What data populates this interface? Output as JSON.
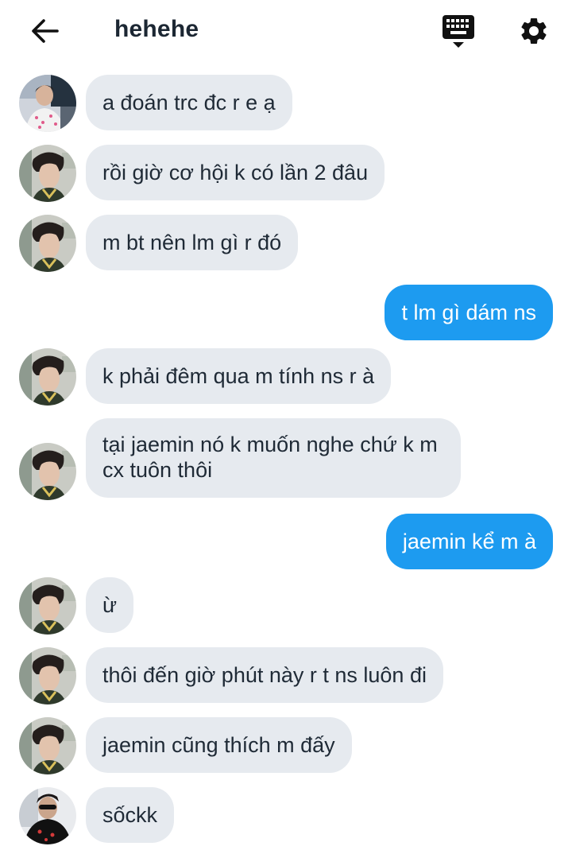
{
  "header": {
    "title": "hehehe",
    "back_icon": "arrow-left-icon",
    "keyboard_icon": "keyboard-icon",
    "settings_icon": "gear-icon"
  },
  "colors": {
    "incoming_bubble": "#e6eaef",
    "outgoing_bubble": "#1d9bf0",
    "outgoing_text": "#ffffff",
    "incoming_text": "#1f2a36"
  },
  "messages": [
    {
      "side": "in",
      "text": "a đoán trc đc r e ạ",
      "avatar": "user-photo-a"
    },
    {
      "side": "in",
      "text": "rồi giờ cơ hội k có lần 2 đâu",
      "avatar": "user-photo-b"
    },
    {
      "side": "in",
      "text": "m bt nên lm gì r đó",
      "avatar": "user-photo-b"
    },
    {
      "side": "out",
      "text": "t lm gì dám ns"
    },
    {
      "side": "in",
      "text": "k phải đêm qua m tính ns r à",
      "avatar": "user-photo-b"
    },
    {
      "side": "in",
      "text": "tại jaemin nó k muốn nghe chứ k m cx tuôn thôi",
      "avatar": "user-photo-b"
    },
    {
      "side": "out",
      "text": "jaemin kể m à"
    },
    {
      "side": "in",
      "text": "ừ",
      "avatar": "user-photo-b"
    },
    {
      "side": "in",
      "text": "thôi đến giờ phút này r t ns luôn đi",
      "avatar": "user-photo-b"
    },
    {
      "side": "in",
      "text": "jaemin cũng thích m đấy",
      "avatar": "user-photo-b"
    },
    {
      "side": "in",
      "text": "sốckk",
      "avatar": "user-photo-c"
    }
  ]
}
